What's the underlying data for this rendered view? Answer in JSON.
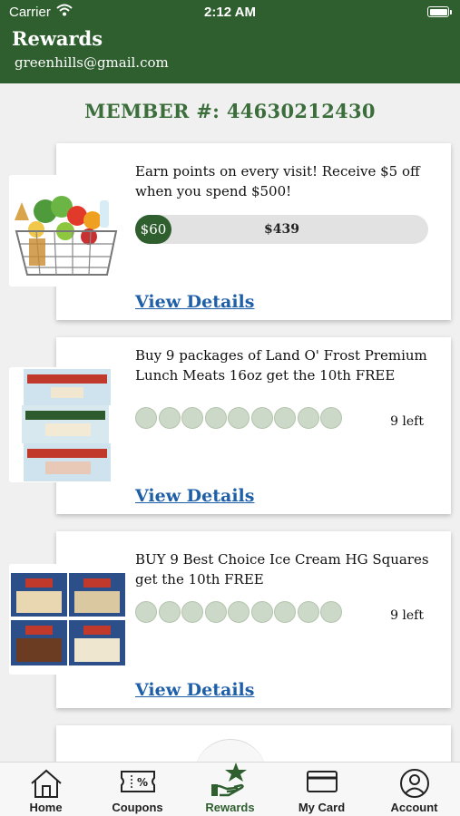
{
  "status": {
    "carrier": "Carrier",
    "time": "2:12 AM"
  },
  "header": {
    "title": "Rewards",
    "email": "greenhills@gmail.com"
  },
  "member": {
    "label": "MEMBER #: 44630212430"
  },
  "rewards": [
    {
      "description": "Earn points on every visit! Receive $5 off when you spend $500!",
      "progress_fraction": 0.12,
      "earned": "$60",
      "remaining": "$439",
      "link": "View Details"
    },
    {
      "description": "Buy 9 packages of Land O' Frost Premium Lunch Meats 16oz get the 10th FREE",
      "punches_total": 9,
      "punches_filled": 0,
      "left": "9 left",
      "link": "View Details"
    },
    {
      "description": "BUY 9 Best Choice Ice Cream HG Squares get the 10th FREE",
      "punches_total": 9,
      "punches_filled": 0,
      "left": "9 left",
      "link": "View Details"
    }
  ],
  "tabs": [
    {
      "label": "Home",
      "icon": "home-icon"
    },
    {
      "label": "Coupons",
      "icon": "coupon-icon"
    },
    {
      "label": "Rewards",
      "icon": "rewards-icon",
      "active": true
    },
    {
      "label": "My Card",
      "icon": "card-icon"
    },
    {
      "label": "Account",
      "icon": "account-icon"
    }
  ],
  "colors": {
    "brand": "#2f5f2f",
    "link": "#1f5fa8",
    "punch": "#cdd9c8"
  }
}
